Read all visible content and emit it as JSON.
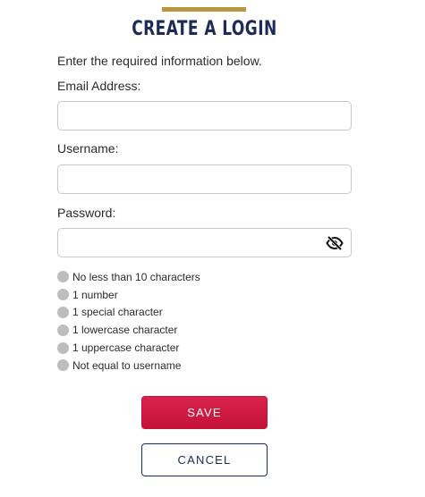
{
  "header": {
    "title": "CREATE A LOGIN",
    "intro": "Enter the required information below."
  },
  "form": {
    "email": {
      "label": "Email Address:",
      "value": "",
      "placeholder": ""
    },
    "username": {
      "label": "Username:",
      "value": "",
      "placeholder": ""
    },
    "password": {
      "label": "Password:",
      "value": "",
      "placeholder": "",
      "toggle_icon": "eye-slash-icon"
    }
  },
  "password_rules": [
    {
      "text": "No less than 10 characters",
      "met": false
    },
    {
      "text": "1 number",
      "met": false
    },
    {
      "text": "1 special character",
      "met": false
    },
    {
      "text": "1 lowercase character",
      "met": false
    },
    {
      "text": "1 uppercase character",
      "met": false
    },
    {
      "text": "Not equal to username",
      "met": false
    }
  ],
  "buttons": {
    "save": "SAVE",
    "cancel": "CANCEL"
  },
  "colors": {
    "accent": "#b8953c",
    "navy": "#1a2c57",
    "primary": "#c8163f",
    "rule_unmet": "#bdbdbd"
  }
}
